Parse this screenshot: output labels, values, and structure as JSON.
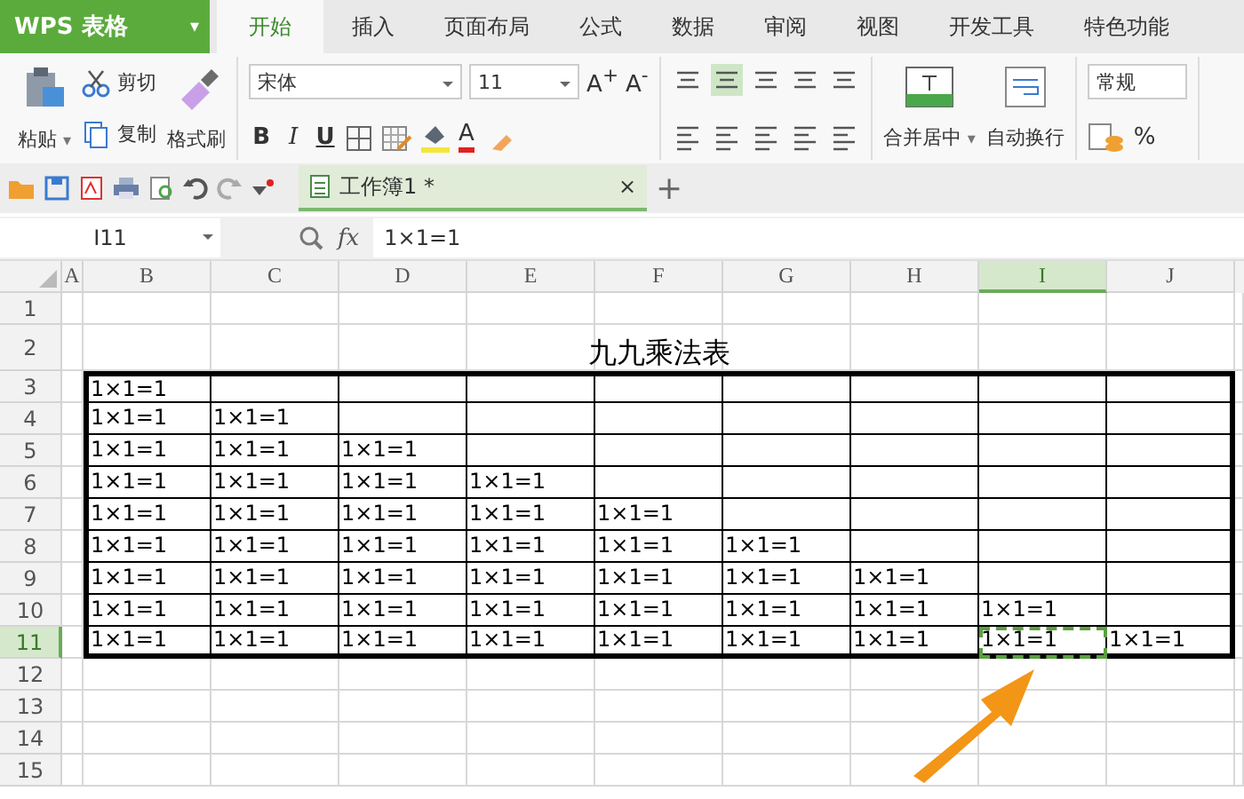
{
  "app_menu": {
    "label": "WPS 表格",
    "caret": "▾"
  },
  "tabs": [
    {
      "label": "开始",
      "selected": true
    },
    {
      "label": "插入",
      "selected": false
    },
    {
      "label": "页面布局",
      "selected": false
    },
    {
      "label": "公式",
      "selected": false
    },
    {
      "label": "数据",
      "selected": false
    },
    {
      "label": "审阅",
      "selected": false
    },
    {
      "label": "视图",
      "selected": false
    },
    {
      "label": "开发工具",
      "selected": false
    },
    {
      "label": "特色功能",
      "selected": false
    }
  ],
  "ribbon": {
    "paste": "粘贴",
    "cut": "剪切",
    "copy": "复制",
    "format_painter": "格式刷",
    "font_name": "宋体",
    "font_size": "11",
    "grow_font": "A$^{+}$",
    "shrink_font": "A$^{-}$",
    "bold": "B",
    "italic": "I",
    "underline": "U",
    "font_color": "A",
    "merge": "合并居中",
    "caret": "▾",
    "wrap": "自动换行",
    "number_format": "常规",
    "percent": "%"
  },
  "document_tab": {
    "title": "工作簿1 *",
    "close": "×",
    "new_tab": "+"
  },
  "formula_bar": {
    "cell_ref": "I11",
    "fx": "fx",
    "value": "1×1=1"
  },
  "sheet": {
    "title": "九九乘法表",
    "columns": [
      {
        "label": "A",
        "selected": false
      },
      {
        "label": "B",
        "selected": false
      },
      {
        "label": "C",
        "selected": false
      },
      {
        "label": "D",
        "selected": false
      },
      {
        "label": "E",
        "selected": false
      },
      {
        "label": "F",
        "selected": false
      },
      {
        "label": "G",
        "selected": false
      },
      {
        "label": "H",
        "selected": false
      },
      {
        "label": "I",
        "selected": true
      },
      {
        "label": "J",
        "selected": false
      }
    ],
    "rows": [
      {
        "label": "1",
        "selected": false
      },
      {
        "label": "2",
        "selected": false
      },
      {
        "label": "3",
        "selected": false,
        "cells": [
          {
            "text": "1×1=1",
            "selected": false
          }
        ]
      },
      {
        "label": "4",
        "selected": false,
        "cells": [
          {
            "text": "1×1=1",
            "selected": false
          },
          {
            "text": "1×1=1",
            "selected": false
          }
        ]
      },
      {
        "label": "5",
        "selected": false,
        "cells": [
          {
            "text": "1×1=1",
            "selected": false
          },
          {
            "text": "1×1=1",
            "selected": false
          },
          {
            "text": "1×1=1",
            "selected": false
          }
        ]
      },
      {
        "label": "6",
        "selected": false,
        "cells": [
          {
            "text": "1×1=1",
            "selected": false
          },
          {
            "text": "1×1=1",
            "selected": false
          },
          {
            "text": "1×1=1",
            "selected": false
          },
          {
            "text": "1×1=1",
            "selected": false
          }
        ]
      },
      {
        "label": "7",
        "selected": false,
        "cells": [
          {
            "text": "1×1=1",
            "selected": false
          },
          {
            "text": "1×1=1",
            "selected": false
          },
          {
            "text": "1×1=1",
            "selected": false
          },
          {
            "text": "1×1=1",
            "selected": false
          },
          {
            "text": "1×1=1",
            "selected": false
          }
        ]
      },
      {
        "label": "8",
        "selected": false,
        "cells": [
          {
            "text": "1×1=1",
            "selected": false
          },
          {
            "text": "1×1=1",
            "selected": false
          },
          {
            "text": "1×1=1",
            "selected": false
          },
          {
            "text": "1×1=1",
            "selected": false
          },
          {
            "text": "1×1=1",
            "selected": false
          },
          {
            "text": "1×1=1",
            "selected": false
          }
        ]
      },
      {
        "label": "9",
        "selected": false,
        "cells": [
          {
            "text": "1×1=1",
            "selected": false
          },
          {
            "text": "1×1=1",
            "selected": false
          },
          {
            "text": "1×1=1",
            "selected": false
          },
          {
            "text": "1×1=1",
            "selected": false
          },
          {
            "text": "1×1=1",
            "selected": false
          },
          {
            "text": "1×1=1",
            "selected": false
          },
          {
            "text": "1×1=1",
            "selected": false
          }
        ]
      },
      {
        "label": "10",
        "selected": false,
        "cells": [
          {
            "text": "1×1=1",
            "selected": false
          },
          {
            "text": "1×1=1",
            "selected": false
          },
          {
            "text": "1×1=1",
            "selected": false
          },
          {
            "text": "1×1=1",
            "selected": false
          },
          {
            "text": "1×1=1",
            "selected": false
          },
          {
            "text": "1×1=1",
            "selected": false
          },
          {
            "text": "1×1=1",
            "selected": false
          },
          {
            "text": "1×1=1",
            "selected": false
          }
        ]
      },
      {
        "label": "11",
        "selected": true,
        "cells": [
          {
            "text": "1×1=1",
            "selected": false
          },
          {
            "text": "1×1=1",
            "selected": false
          },
          {
            "text": "1×1=1",
            "selected": false
          },
          {
            "text": "1×1=1",
            "selected": false
          },
          {
            "text": "1×1=1",
            "selected": false
          },
          {
            "text": "1×1=1",
            "selected": false
          },
          {
            "text": "1×1=1",
            "selected": false
          },
          {
            "text": "1×1=1",
            "selected": true
          },
          {
            "text": "1×1=1",
            "selected": false
          }
        ]
      },
      {
        "label": "12",
        "selected": false
      },
      {
        "label": "13",
        "selected": false
      },
      {
        "label": "14",
        "selected": false
      },
      {
        "label": "15",
        "selected": false
      }
    ]
  }
}
